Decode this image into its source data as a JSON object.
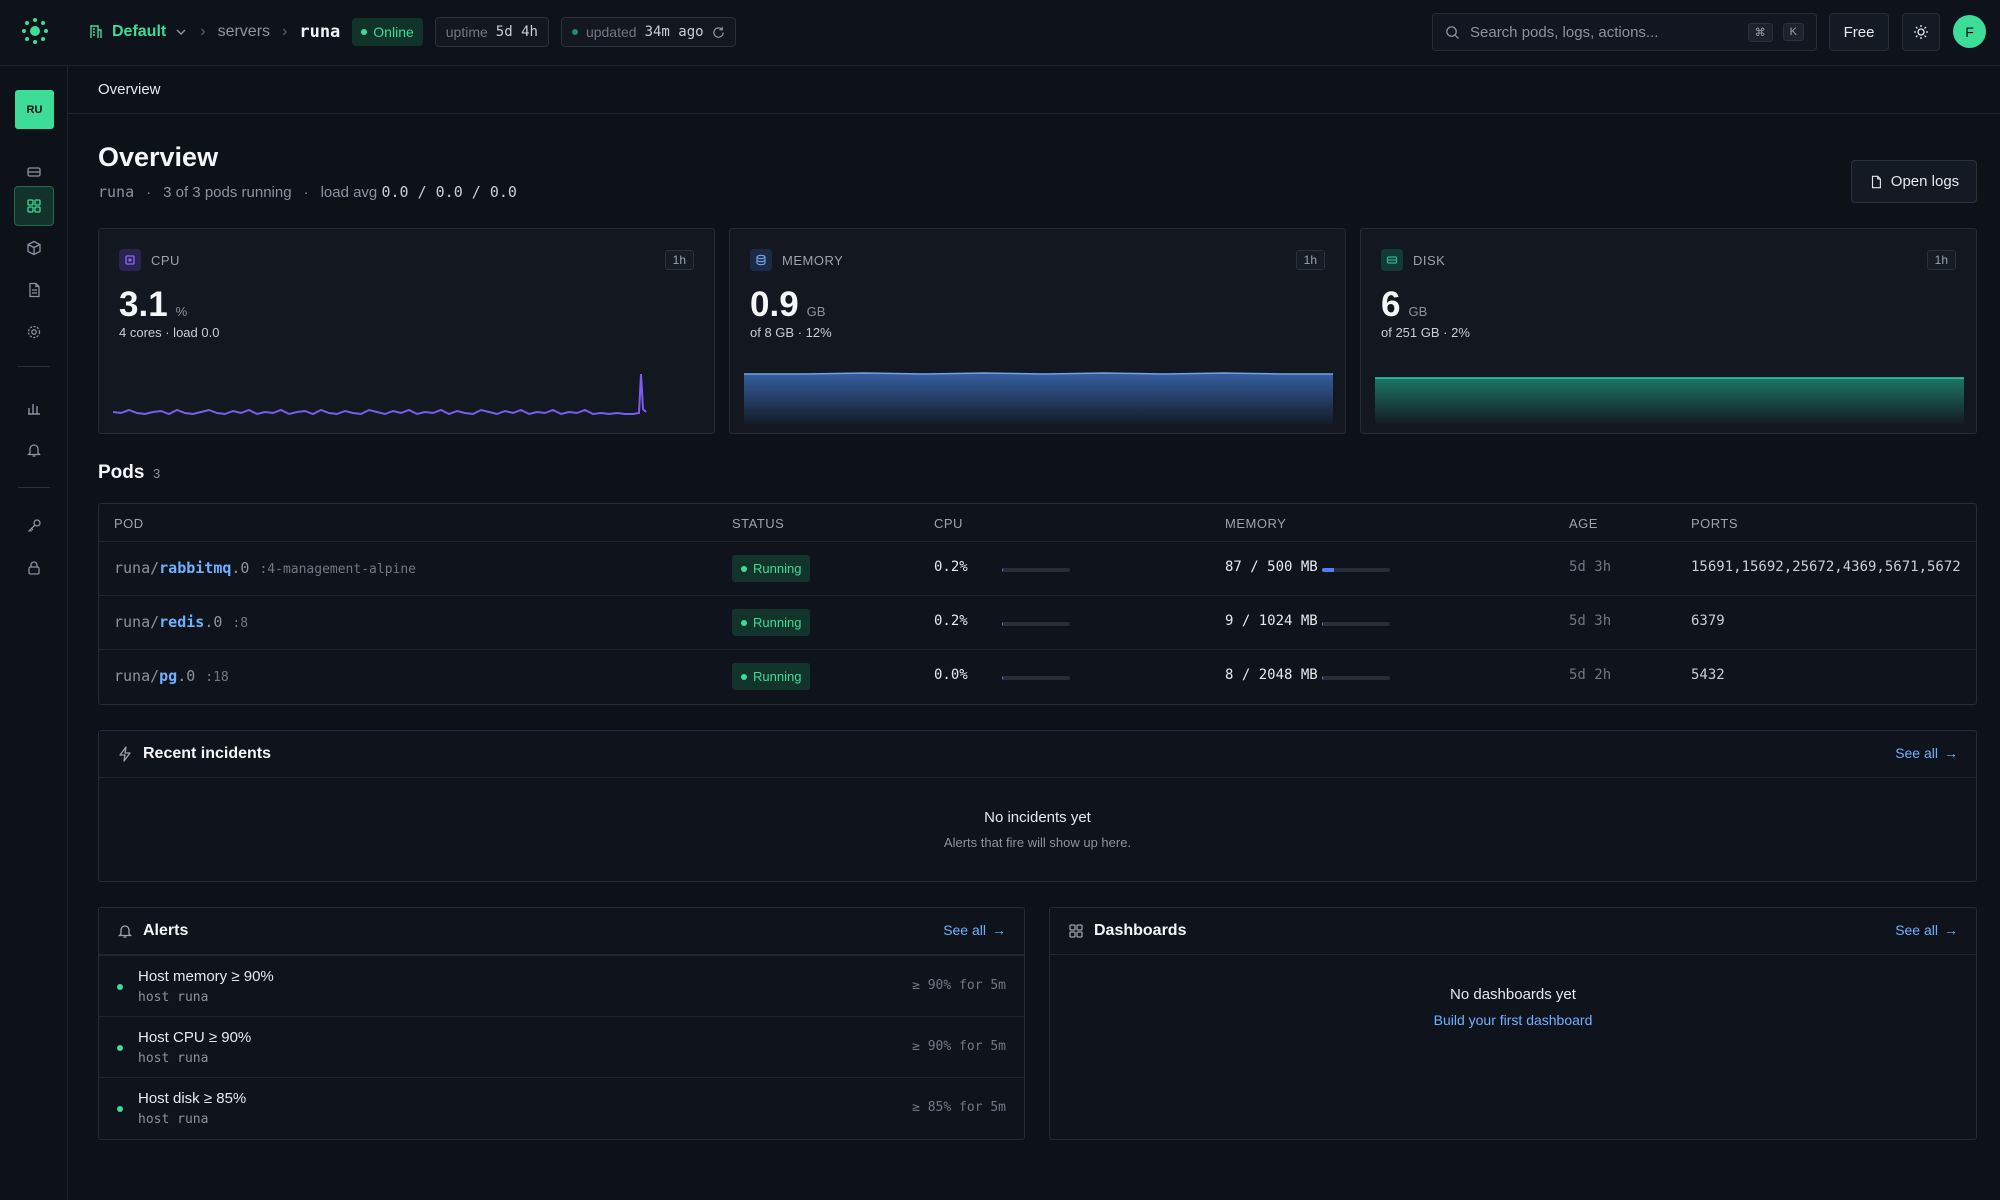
{
  "topbar": {
    "workspace": "Default",
    "breadcrumb": [
      "servers",
      "runa"
    ],
    "status": "Online",
    "uptime_label": "uptime",
    "uptime_value": "5d 4h",
    "updated_label": "updated",
    "updated_value": "34m ago",
    "search_placeholder": "Search pods, logs, actions...",
    "kbd": [
      "⌘",
      "K"
    ],
    "plan": "Free",
    "avatar": "F"
  },
  "sidebar": {
    "badge": "RU",
    "icons": [
      "server-icon",
      "grid-icon",
      "box-icon",
      "file-icon",
      "gear-icon",
      "chart-icon",
      "bell-icon",
      "key-icon",
      "lock-icon"
    ]
  },
  "subheader": {
    "title": "Overview"
  },
  "page": {
    "title": "Overview",
    "host": "runa",
    "pods_running": "3 of 3 pods running",
    "load_label": "load avg",
    "load_values": "0.0 / 0.0 / 0.0",
    "open_logs": "Open logs"
  },
  "metrics": [
    {
      "label": "CPU",
      "range": "1h",
      "value": "3.1",
      "unit": "%",
      "sub": "4 cores · load 0.0",
      "color": "#7b5cf0"
    },
    {
      "label": "MEMORY",
      "range": "1h",
      "value": "0.9",
      "unit": "GB",
      "sub": "of 8 GB · 12%",
      "color": "#4f86d9"
    },
    {
      "label": "DISK",
      "range": "1h",
      "value": "6",
      "unit": "GB",
      "sub": "of 251 GB · 2%",
      "color": "#2bb89a"
    }
  ],
  "pods": {
    "title": "Pods",
    "count": "3",
    "columns": [
      "POD",
      "STATUS",
      "CPU",
      "MEMORY",
      "AGE",
      "PORTS"
    ],
    "rows": [
      {
        "prefix": "runa/",
        "name": "rabbitmq",
        "suffix": ".0",
        "tag": ":4-management-alpine",
        "status": "Running",
        "cpu": "0.2%",
        "cpu_pct": 2,
        "memory": "87 / 500 MB",
        "mem_pct": 17.4,
        "age": "5d 3h",
        "ports": "15691,15692,25672,4369,5671,5672,…"
      },
      {
        "prefix": "runa/",
        "name": "redis",
        "suffix": ".0",
        "tag": ":8",
        "status": "Running",
        "cpu": "0.2%",
        "cpu_pct": 2,
        "memory": "9 / 1024 MB",
        "mem_pct": 1,
        "age": "5d 3h",
        "ports": "6379"
      },
      {
        "prefix": "runa/",
        "name": "pg",
        "suffix": ".0",
        "tag": ":18",
        "status": "Running",
        "cpu": "0.0%",
        "cpu_pct": 0,
        "memory": "8 / 2048 MB",
        "mem_pct": 0.5,
        "age": "5d 2h",
        "ports": "5432"
      }
    ]
  },
  "incidents": {
    "title": "Recent incidents",
    "see_all": "See all",
    "empty_title": "No incidents yet",
    "empty_sub": "Alerts that fire will show up here."
  },
  "alerts": {
    "title": "Alerts",
    "see_all": "See all",
    "items": [
      {
        "name": "Host memory ≥ 90%",
        "host": "host runa",
        "cond": "≥ 90% for 5m"
      },
      {
        "name": "Host CPU ≥ 90%",
        "host": "host runa",
        "cond": "≥ 90% for 5m"
      },
      {
        "name": "Host disk ≥ 85%",
        "host": "host runa",
        "cond": "≥ 85% for 5m"
      }
    ]
  },
  "dashboards": {
    "title": "Dashboards",
    "see_all": "See all",
    "empty_title": "No dashboards yet",
    "empty_link": "Build your first dashboard"
  }
}
